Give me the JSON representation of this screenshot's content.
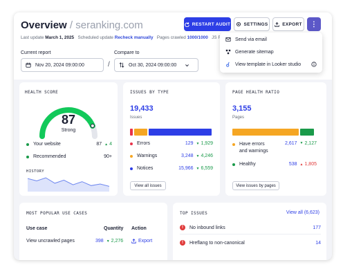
{
  "header": {
    "title": "Overview",
    "domain": "/ seranking.com",
    "last_update_label": "Last update",
    "last_update_value": "March 1, 2025",
    "scheduled_label": "Scheduled update",
    "scheduled_value": "Recheck manually",
    "pages_crawled_label": "Pages crawled",
    "pages_crawled_value": "1000/1000",
    "js_label": "JS R"
  },
  "toolbar": {
    "restart_label": "RESTART AUDIT",
    "settings_label": "SETTINGS",
    "export_label": "EXPORT",
    "more_label": "⋮"
  },
  "dropdown": {
    "items": [
      "Send via email",
      "Generate sitemap",
      "View template in Looker studio"
    ]
  },
  "filters": {
    "current_label": "Current report",
    "current_value": "Nov 20, 2024 09:00:00",
    "compare_label": "Compare to",
    "compare_value": "Oct 30, 2024 09:00:00",
    "separator": "/"
  },
  "health": {
    "title": "HEALTH SCORE",
    "score": "87",
    "score_value": 87,
    "status": "Strong",
    "website_label": "Your website",
    "website_value": "87",
    "website_delta": "4",
    "recommended_label": "Recommended",
    "recommended_value": "90+",
    "history_label": "HISTORY",
    "history_values": [
      58,
      52,
      60,
      46,
      54,
      42,
      50,
      40,
      44,
      38
    ]
  },
  "issues": {
    "title": "ISSUES BY TYPE",
    "total": "19,433",
    "subtitle": "Issues",
    "bar_values": [
      129,
      3248,
      15966
    ],
    "rows": [
      {
        "label": "Errors",
        "value": "129",
        "delta": "1,929",
        "color": "#e8334a"
      },
      {
        "label": "Warnings",
        "value": "3,248",
        "delta": "4,246",
        "color": "#f5a623"
      },
      {
        "label": "Notices",
        "value": "15,966",
        "delta": "6,559",
        "color": "#2d3ee6"
      }
    ],
    "button_label": "View all issues"
  },
  "pagehealth": {
    "title": "PAGE HEALTH RATIO",
    "total": "3,155",
    "subtitle": "Pages",
    "bar_values": [
      2617,
      538
    ],
    "rows": [
      {
        "label": "Have errors",
        "label2": "and warnings",
        "value": "2,617",
        "delta": "2,127",
        "color": "#f5a623"
      },
      {
        "label": "Healthy",
        "label2": "",
        "value": "538",
        "delta": "1,805",
        "color": "#1a9a4a"
      }
    ],
    "button_label": "View issues by pages"
  },
  "usecases": {
    "title": "MOST POPULAR USE CASES",
    "col_usecase": "Use case",
    "col_quantity": "Quantity",
    "col_action": "Action",
    "row_label": "View uncrawled pages",
    "row_value": "398",
    "row_delta": "2,276",
    "row_action": "Export"
  },
  "topissues": {
    "title": "TOP ISSUES",
    "view_all": "View all (6,623)",
    "rows": [
      {
        "label": "No inbound links",
        "value": "177"
      },
      {
        "label": "Hreflang to non-canonical",
        "value": "14"
      }
    ]
  },
  "colors": {
    "accent": "#2d3ee6",
    "success": "#1a9a4a",
    "danger": "#e03b3b",
    "warning": "#f5a623",
    "gauge_track": "#e4e6ec"
  }
}
